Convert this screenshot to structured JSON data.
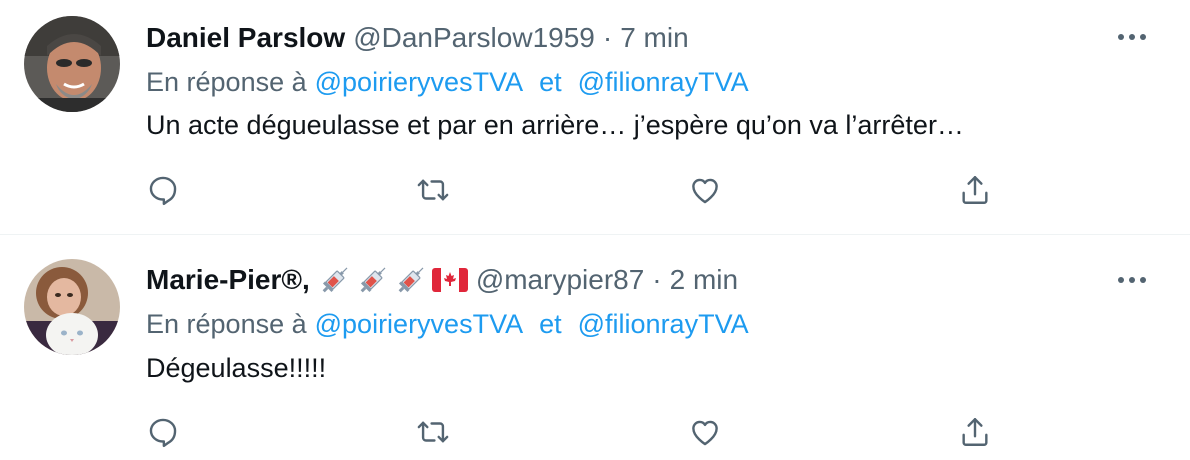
{
  "tweets": [
    {
      "display_name": "Daniel Parslow",
      "emoji_suffix": [],
      "handle": "@DanParslow1959",
      "separator": "·",
      "time": "7 min",
      "reply_prefix": "En réponse à",
      "reply_mentions": [
        "@poirieryvesTVA",
        "@filionrayTVA"
      ],
      "reply_conjunction": "et",
      "text": "Un acte dégueulasse et par en arrière… j’espère qu’on va l’arrêter…",
      "avatar_icon": "man-avatar",
      "actions": [
        "reply-icon",
        "retweet-icon",
        "like-icon",
        "share-icon"
      ]
    },
    {
      "display_name": "Marie-Pier®,",
      "emoji_suffix": [
        "syringe-icon",
        "syringe-icon",
        "syringe-icon",
        "canada-flag-icon"
      ],
      "handle": "@marypier87",
      "separator": "·",
      "time": "2 min",
      "reply_prefix": "En réponse à",
      "reply_mentions": [
        "@poirieryvesTVA",
        "@filionrayTVA"
      ],
      "reply_conjunction": "et",
      "text": "Dégeulasse!!!!!",
      "avatar_icon": "woman-with-cat-avatar",
      "actions": [
        "reply-icon",
        "retweet-icon",
        "like-icon",
        "share-icon"
      ]
    }
  ],
  "colors": {
    "text_primary": "#0f1419",
    "text_secondary": "#536471",
    "link": "#1d9bf0",
    "divider": "#eff3f4"
  }
}
